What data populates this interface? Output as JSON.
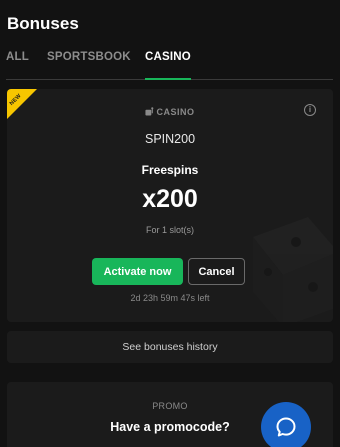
{
  "header": {
    "title": "Bonuses"
  },
  "tabs": [
    {
      "label": "ALL"
    },
    {
      "label": "SPORTSBOOK"
    },
    {
      "label": "CASINO"
    }
  ],
  "active_tab": "CASINO",
  "bonus_card": {
    "ribbon": "NEW",
    "category": "CASINO",
    "category_icon": "slot-icon",
    "code": "SPIN200",
    "type": "Freespins",
    "amount": "x200",
    "subtitle": "For 1 slot(s)",
    "activate_label": "Activate now",
    "cancel_label": "Cancel",
    "time_left": "2d 23h 59m 47s left"
  },
  "history": {
    "label": "See bonuses history"
  },
  "promo": {
    "label": "PROMO",
    "question": "Have a promocode?"
  },
  "chat": {
    "icon": "chat-bubble-icon"
  },
  "colors": {
    "background": "#121212",
    "card": "#1b1b1b",
    "accent_green": "#18b65a",
    "ribbon_yellow": "#f7c600",
    "chat_blue": "#1862c6"
  }
}
